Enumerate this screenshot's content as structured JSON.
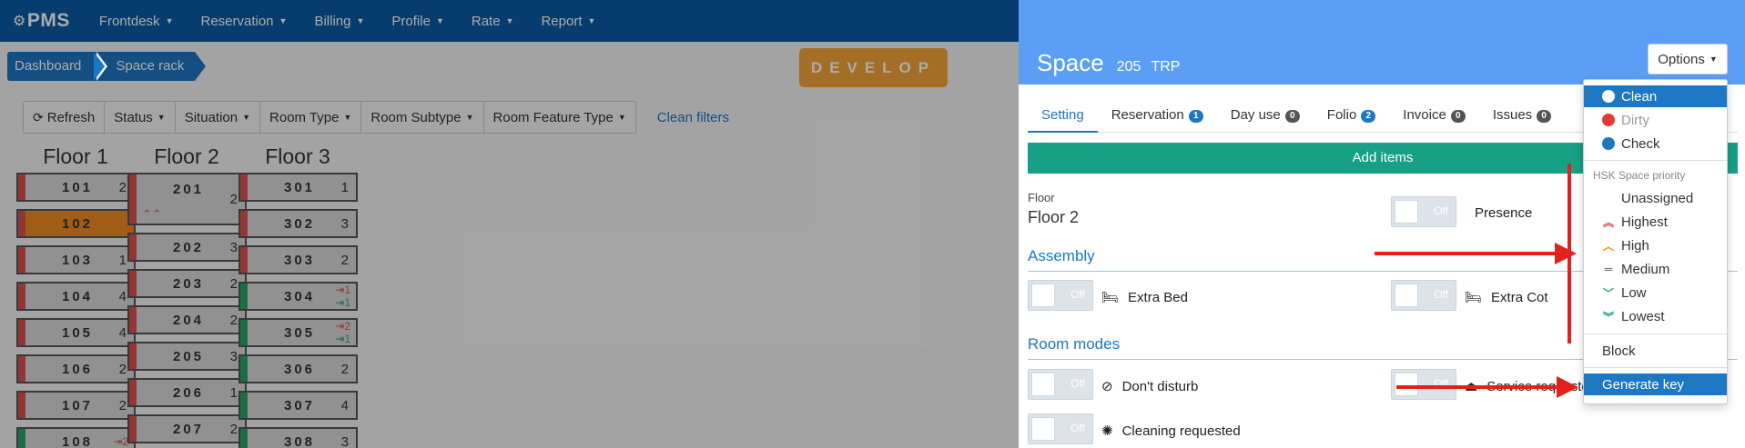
{
  "nav": {
    "logo": "PMS",
    "items": [
      {
        "label": "Frontdesk"
      },
      {
        "label": "Reservation"
      },
      {
        "label": "Billing"
      },
      {
        "label": "Profile"
      },
      {
        "label": "Rate"
      },
      {
        "label": "Report"
      }
    ]
  },
  "breadcrumb": [
    "Dashboard",
    "Space rack"
  ],
  "env_badge": "DEVELOP",
  "toolbar": {
    "refresh": "Refresh",
    "filters": [
      "Status",
      "Situation",
      "Room Type",
      "Room Subtype",
      "Room Feature Type"
    ],
    "clean_filters": "Clean filters"
  },
  "floors": [
    {
      "title": "Floor 1",
      "rooms": [
        {
          "num": "101",
          "count": "2"
        },
        {
          "num": "102",
          "count": ""
        },
        {
          "num": "103",
          "count": "1"
        },
        {
          "num": "104",
          "count": "4"
        },
        {
          "num": "105",
          "count": "4"
        },
        {
          "num": "106",
          "count": "2"
        },
        {
          "num": "107",
          "count": "2"
        },
        {
          "num": "108",
          "count": "",
          "arrow_in": "2"
        }
      ]
    },
    {
      "title": "Floor 2",
      "rooms": [
        {
          "num": "201",
          "count": "2"
        },
        {
          "num": "202",
          "count": "3"
        },
        {
          "num": "203",
          "count": "2"
        },
        {
          "num": "204",
          "count": "2"
        },
        {
          "num": "205",
          "count": "3"
        },
        {
          "num": "206",
          "count": "1"
        },
        {
          "num": "207",
          "count": "2"
        }
      ]
    },
    {
      "title": "Floor 3",
      "rooms": [
        {
          "num": "301",
          "count": "1"
        },
        {
          "num": "302",
          "count": "3"
        },
        {
          "num": "303",
          "count": "2"
        },
        {
          "num": "304",
          "count": "",
          "arrow_in": "1",
          "arrow_out": "1"
        },
        {
          "num": "305",
          "count": "",
          "arrow_in": "2",
          "arrow_out": "1"
        },
        {
          "num": "306",
          "count": "2"
        },
        {
          "num": "307",
          "count": "4"
        },
        {
          "num": "308",
          "count": "3"
        }
      ]
    }
  ],
  "panel": {
    "title": "Space",
    "number": "205",
    "type": "TRP",
    "options_label": "Options",
    "tabs": [
      {
        "label": "Setting",
        "badge": ""
      },
      {
        "label": "Reservation",
        "badge": "1"
      },
      {
        "label": "Day use",
        "badge": "0"
      },
      {
        "label": "Folio",
        "badge": "2"
      },
      {
        "label": "Invoice",
        "badge": "0"
      },
      {
        "label": "Issues",
        "badge": "0"
      }
    ],
    "add_items": "Add items",
    "floor_label": "Floor",
    "floor_value": "Floor 2",
    "toggle_off": "Off",
    "presence": "Presence",
    "assembly_title": "Assembly",
    "extra_bed": "Extra Bed",
    "extra_cot": "Extra Cot",
    "room_modes_title": "Room modes",
    "dont_disturb": "Don't disturb",
    "service_requested": "Service requested",
    "cleaning_requested": "Cleaning requested"
  },
  "dropdown": {
    "status_items": [
      {
        "label": "Clean",
        "color": "#ffffff"
      },
      {
        "label": "Dirty",
        "color": "#e53935"
      },
      {
        "label": "Check",
        "color": "#1d77c2"
      }
    ],
    "priority_header": "HSK Space priority",
    "priority_items": [
      {
        "label": "Unassigned",
        "icon": ""
      },
      {
        "label": "Highest",
        "icon": "double-chevron-up"
      },
      {
        "label": "High",
        "icon": "chevron-up"
      },
      {
        "label": "Medium",
        "icon": "equals"
      },
      {
        "label": "Low",
        "icon": "chevron-down"
      },
      {
        "label": "Lowest",
        "icon": "double-chevron-down"
      }
    ],
    "block": "Block",
    "generate_key": "Generate key"
  },
  "colors": {
    "nav_bg": "#0a5aa5",
    "panel_header": "#5b9ef5",
    "add_items_bg": "#16a086",
    "accent": "#1d77c2",
    "annotation": "#e3211c"
  }
}
